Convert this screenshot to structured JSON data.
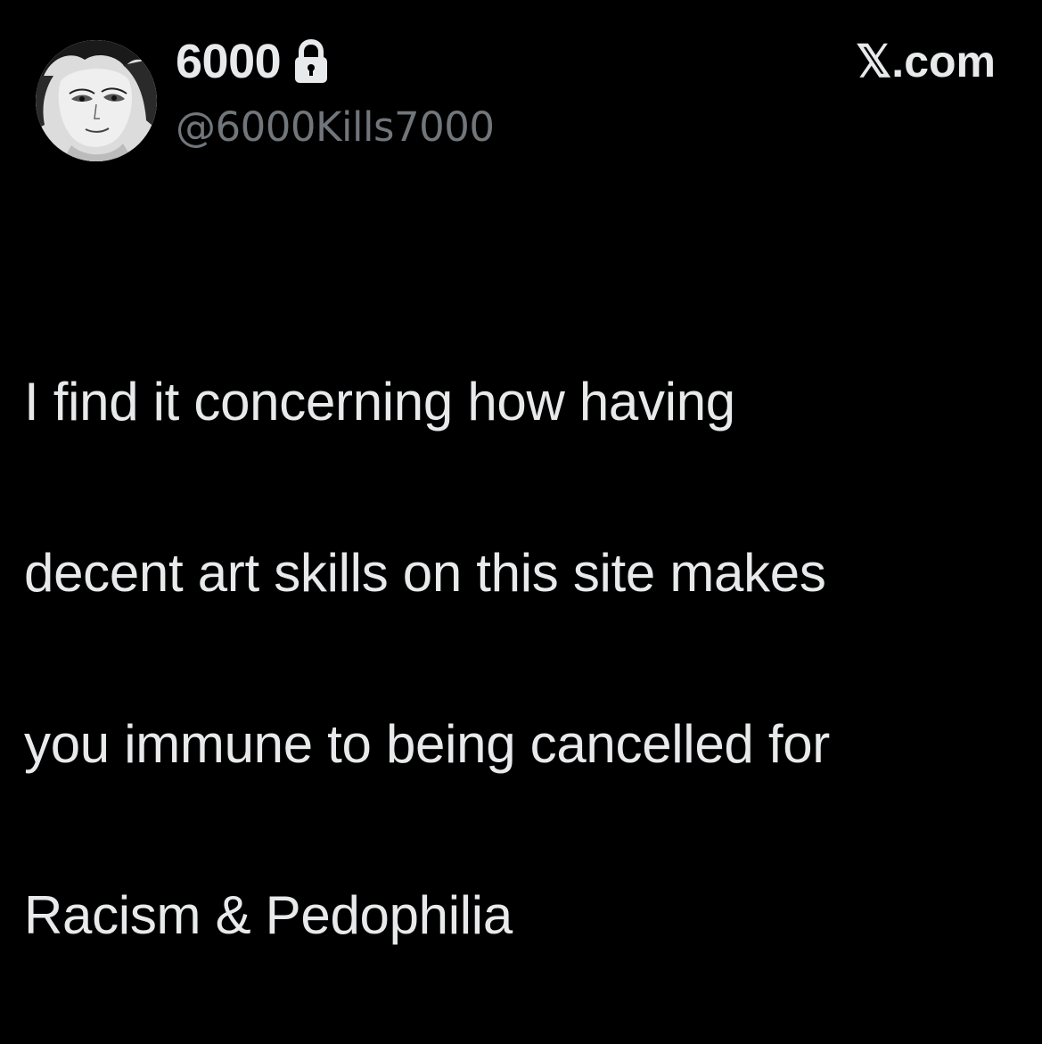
{
  "tweet": {
    "author": {
      "display_name": "6000",
      "handle": "@6000Kills7000",
      "avatar_icon": "manga-character-avatar",
      "protected_icon": "lock-icon"
    },
    "brand": "𝕏.com",
    "text_lines": [
      "I find it concerning how having",
      "decent art skills on this site makes",
      "you immune to being cancelled for",
      "Racism & Pedophilia"
    ]
  },
  "colors": {
    "background": "#000000",
    "primary_text": "#e7e9ea",
    "secondary_text": "#71767b"
  }
}
